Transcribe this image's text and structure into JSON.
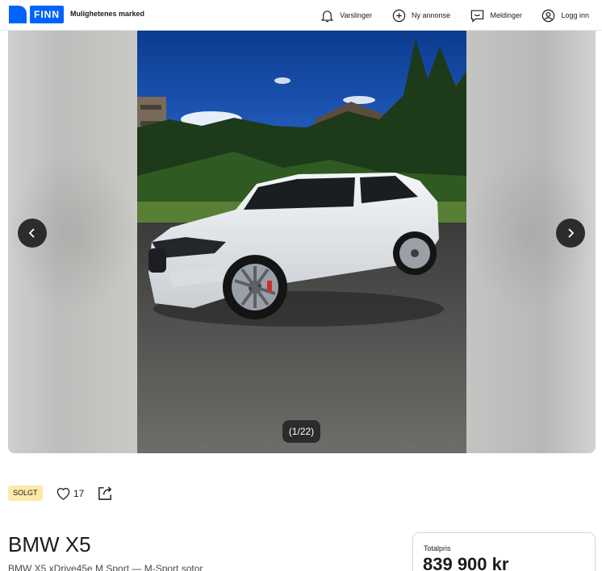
{
  "header": {
    "logo_text": "FINN",
    "tagline": "Mulighetenes marked",
    "nav": [
      {
        "label": "Varslinger",
        "icon": "bell-icon"
      },
      {
        "label": "Ny annonse",
        "icon": "plus-circle-icon"
      },
      {
        "label": "Meldinger",
        "icon": "chat-icon"
      },
      {
        "label": "Logg inn",
        "icon": "user-icon"
      }
    ]
  },
  "gallery": {
    "counter": "(1/22)",
    "prev_icon": "chevron-left-icon",
    "next_icon": "chevron-right-icon"
  },
  "listing": {
    "status_badge": "SOLGT",
    "favorite_count": "17",
    "title": "BMW X5",
    "subtitle": "BMW X5 xDrive45e M Sport — M-Sport sotor",
    "price_label": "Totalpris",
    "price": "839 900 kr"
  },
  "colors": {
    "brand": "#0063fb",
    "badge_bg": "#fde9a8",
    "arrow_bg": "#2c2c2c"
  }
}
